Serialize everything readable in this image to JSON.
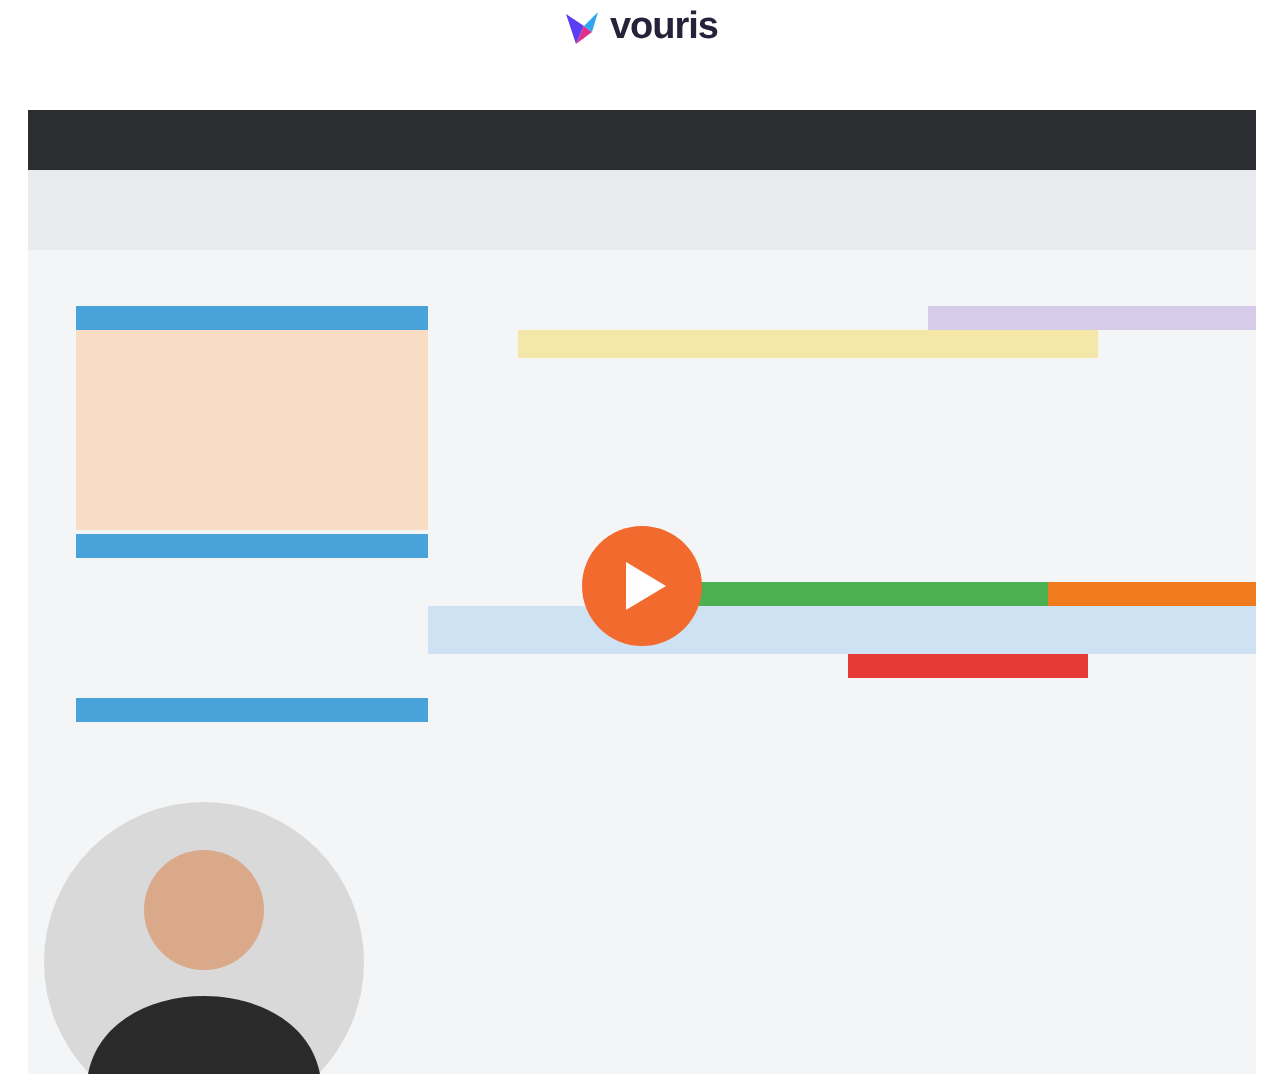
{
  "logo": {
    "text": "vouris"
  }
}
